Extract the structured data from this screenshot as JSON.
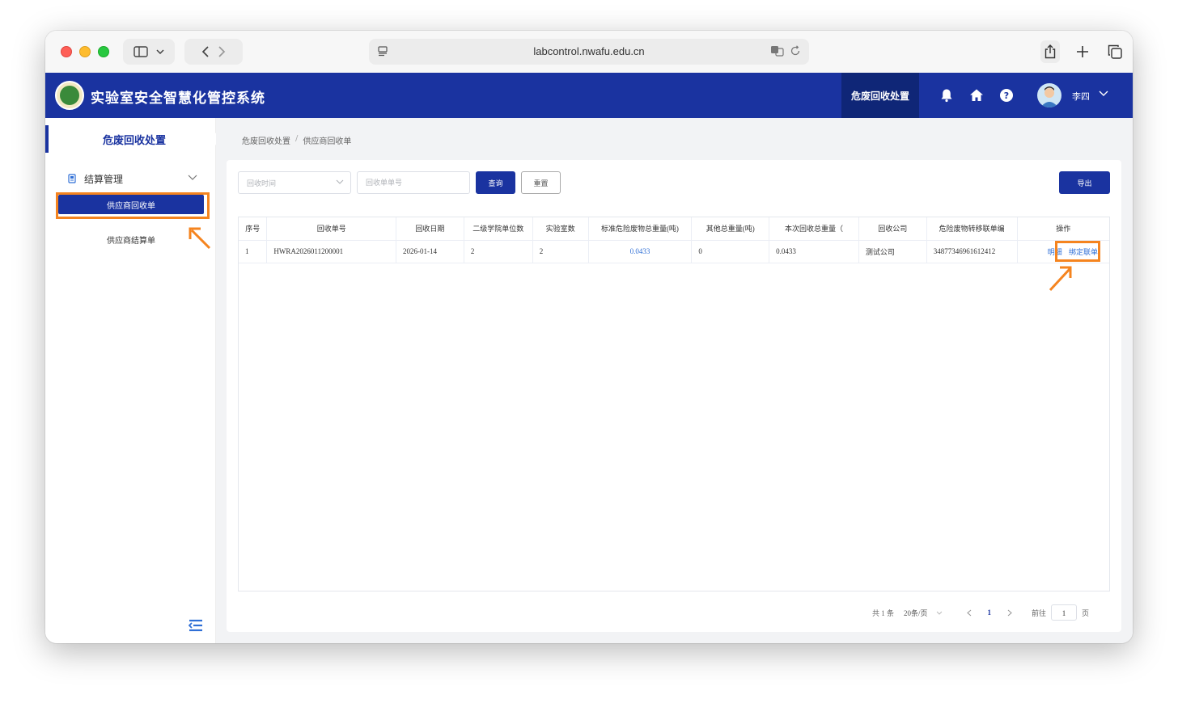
{
  "browser": {
    "url": "labcontrol.nwafu.edu.cn"
  },
  "header": {
    "title": "实验室安全智慧化管控系统",
    "active_module": "危废回收处置",
    "user_name": "李四"
  },
  "sidebar": {
    "module_title": "危废回收处置",
    "group_label": "结算管理",
    "items": [
      {
        "label": "供应商回收单",
        "active": true
      },
      {
        "label": "供应商结算单",
        "active": false
      }
    ]
  },
  "breadcrumb": [
    "危废回收处置",
    "供应商回收单"
  ],
  "filters": {
    "time_placeholder": "回收时间",
    "order_placeholder": "回收单单号",
    "query_label": "查询",
    "reset_label": "重置",
    "export_label": "导出"
  },
  "table": {
    "columns": [
      "序号",
      "回收单号",
      "回收日期",
      "二级学院单位数",
      "实验室数",
      "标准危险废物总重量(吨)",
      "其他总重量(吨)",
      "本次回收总重量（",
      "回收公司",
      "危险废物转移联单编",
      "操作"
    ],
    "rows": [
      {
        "index": "1",
        "order_no": "HWRA2026011200001",
        "date": "2026-01-14",
        "college_count": "2",
        "lab_count": "2",
        "std_weight": "0.0433",
        "other_weight": "0",
        "total_weight": "0.0433",
        "company": "测试公司",
        "transfer_no": "34877346961612412",
        "action_detail": "明细",
        "action_bind": "绑定联单"
      }
    ]
  },
  "pagination": {
    "total": "共 1 条",
    "page_size": "20条/页",
    "current_page": "1",
    "goto_label": "前往",
    "goto_value": "1",
    "page_suffix": "页"
  },
  "colors": {
    "brand": "#1a33a0",
    "highlight": "#f5841f",
    "link": "#2f6fd6"
  }
}
